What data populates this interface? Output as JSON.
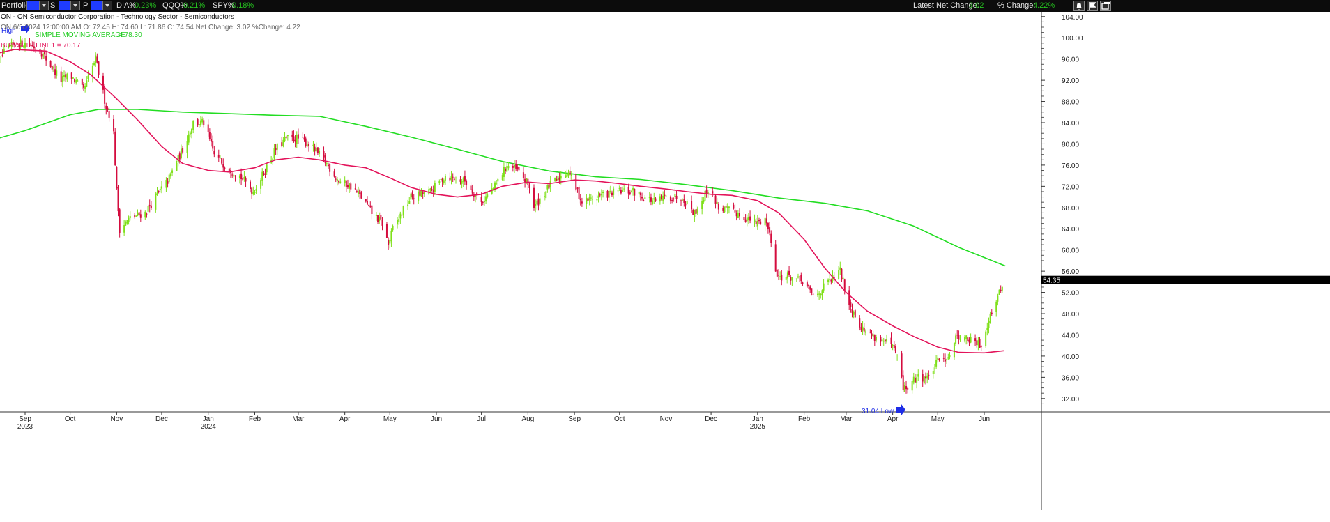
{
  "toolbar": {
    "portfolio_label": "Portfolio",
    "s_label": "S",
    "p_label": "P",
    "tickers": [
      {
        "name": "DIA%",
        "value": "0.23%"
      },
      {
        "name": "QQQ%",
        "value": "0.21%"
      },
      {
        "name": "SPY%",
        "value": "0.18%"
      }
    ],
    "latest_net_change_label": "Latest Net Change:",
    "latest_net_change_value": "3.02",
    "pct_change_label": "% Change:",
    "pct_change_value": "4.22%",
    "icons": [
      "bell-icon",
      "flag-icon",
      "window-icon"
    ]
  },
  "header": {
    "title": "ON - ON Semiconductor Corporation - Technology Sector - Semiconductors",
    "ohlc": "ON 6/5/2024 12:00:00 AM O: 72.45 H: 74.60 L: 71.86 C: 74.54 Net Change: 3.02  %Change: 4.22",
    "sma_label": "SIMPLE MOVING AVERAGE",
    "sma_value": "= 78.30",
    "bsl_label": "BUY/SELL LINE1 = 70.17",
    "high_marker": "High"
  },
  "colors": {
    "up": "#7fe01a",
    "down": "#d40c3e",
    "sma": "#22dd22",
    "bsl": "#e3135a",
    "marker": "#1e2de6"
  },
  "chart_data": {
    "type": "candlestick",
    "ylim": [
      31,
      105
    ],
    "yticks": [
      104,
      100,
      96,
      92,
      88,
      84,
      80,
      76,
      72,
      68,
      64,
      60,
      56,
      52,
      48,
      44,
      40,
      36,
      32
    ],
    "last_price": "54.35",
    "low_annotation": "31.04 Low",
    "months": [
      {
        "label": "Sep",
        "year": "2023",
        "date": "2023-09-01"
      },
      {
        "label": "Oct",
        "date": "2023-10-01"
      },
      {
        "label": "Nov",
        "date": "2023-11-01"
      },
      {
        "label": "Dec",
        "date": "2023-12-01"
      },
      {
        "label": "Jan",
        "year": "2024",
        "date": "2024-01-01"
      },
      {
        "label": "Feb",
        "date": "2024-02-01"
      },
      {
        "label": "Mar",
        "date": "2024-03-01"
      },
      {
        "label": "Apr",
        "date": "2024-04-01"
      },
      {
        "label": "May",
        "date": "2024-05-01"
      },
      {
        "label": "Jun",
        "date": "2024-06-01"
      },
      {
        "label": "Jul",
        "date": "2024-07-01"
      },
      {
        "label": "Aug",
        "date": "2024-08-01"
      },
      {
        "label": "Sep",
        "date": "2024-09-01"
      },
      {
        "label": "Oct",
        "date": "2024-10-01"
      },
      {
        "label": "Nov",
        "date": "2024-11-01"
      },
      {
        "label": "Dec",
        "date": "2024-12-01"
      },
      {
        "label": "Jan",
        "year": "2025",
        "date": "2025-01-01"
      },
      {
        "label": "Feb",
        "date": "2025-02-01"
      },
      {
        "label": "Mar",
        "date": "2025-03-01"
      },
      {
        "label": "Apr",
        "date": "2025-04-01"
      },
      {
        "label": "May",
        "date": "2025-05-01"
      },
      {
        "label": "Jun",
        "date": "2025-06-01"
      }
    ],
    "price_path": [
      [
        "2023-08-08",
        91
      ],
      [
        "2023-08-12",
        95
      ],
      [
        "2023-08-18",
        97
      ],
      [
        "2023-08-25",
        99
      ],
      [
        "2023-09-01",
        99
      ],
      [
        "2023-09-10",
        98
      ],
      [
        "2023-09-15",
        96
      ],
      [
        "2023-09-25",
        92
      ],
      [
        "2023-10-01",
        93
      ],
      [
        "2023-10-10",
        90
      ],
      [
        "2023-10-18",
        96
      ],
      [
        "2023-10-25",
        87
      ],
      [
        "2023-10-28",
        85
      ],
      [
        "2023-10-30",
        82
      ],
      [
        "2023-11-01",
        71
      ],
      [
        "2023-11-03",
        64
      ],
      [
        "2023-11-10",
        66
      ],
      [
        "2023-11-20",
        67
      ],
      [
        "2023-11-27",
        70
      ],
      [
        "2023-12-05",
        73
      ],
      [
        "2023-12-15",
        79
      ],
      [
        "2023-12-22",
        84
      ],
      [
        "2023-12-29",
        84
      ],
      [
        "2024-01-05",
        78
      ],
      [
        "2024-01-12",
        76
      ],
      [
        "2024-01-22",
        74
      ],
      [
        "2024-01-31",
        71
      ],
      [
        "2024-02-06",
        74
      ],
      [
        "2024-02-15",
        79
      ],
      [
        "2024-02-22",
        81
      ],
      [
        "2024-03-01",
        81
      ],
      [
        "2024-03-08",
        80
      ],
      [
        "2024-03-18",
        77
      ],
      [
        "2024-03-28",
        73
      ],
      [
        "2024-04-05",
        72
      ],
      [
        "2024-04-12",
        70
      ],
      [
        "2024-04-19",
        67
      ],
      [
        "2024-04-26",
        65
      ],
      [
        "2024-04-30",
        61
      ],
      [
        "2024-05-03",
        64
      ],
      [
        "2024-05-15",
        70
      ],
      [
        "2024-05-28",
        71
      ],
      [
        "2024-06-07",
        74
      ],
      [
        "2024-06-20",
        73
      ],
      [
        "2024-07-01",
        69
      ],
      [
        "2024-07-10",
        72
      ],
      [
        "2024-07-18",
        76
      ],
      [
        "2024-07-25",
        75
      ],
      [
        "2024-08-02",
        72
      ],
      [
        "2024-08-05",
        68
      ],
      [
        "2024-08-15",
        72
      ],
      [
        "2024-08-28",
        75
      ],
      [
        "2024-09-06",
        69
      ],
      [
        "2024-09-15",
        70
      ],
      [
        "2024-09-30",
        71
      ],
      [
        "2024-10-10",
        71
      ],
      [
        "2024-10-25",
        69
      ],
      [
        "2024-11-01",
        70
      ],
      [
        "2024-11-12",
        70
      ],
      [
        "2024-11-20",
        67
      ],
      [
        "2024-11-30",
        72
      ],
      [
        "2024-12-06",
        68
      ],
      [
        "2024-12-18",
        67
      ],
      [
        "2024-12-31",
        65
      ],
      [
        "2025-01-06",
        66
      ],
      [
        "2025-01-10",
        62
      ],
      [
        "2025-01-14",
        55
      ],
      [
        "2025-01-22",
        55
      ],
      [
        "2025-01-31",
        54
      ],
      [
        "2025-02-08",
        51
      ],
      [
        "2025-02-14",
        53
      ],
      [
        "2025-02-25",
        56
      ],
      [
        "2025-03-03",
        50
      ],
      [
        "2025-03-12",
        45
      ],
      [
        "2025-03-24",
        43
      ],
      [
        "2025-03-31",
        42
      ],
      [
        "2025-04-04",
        40
      ],
      [
        "2025-04-08",
        34
      ],
      [
        "2025-04-11",
        34
      ],
      [
        "2025-04-17",
        36
      ],
      [
        "2025-04-25",
        36
      ],
      [
        "2025-05-01",
        39
      ],
      [
        "2025-05-08",
        40
      ],
      [
        "2025-05-14",
        44
      ],
      [
        "2025-05-22",
        43
      ],
      [
        "2025-05-30",
        42
      ],
      [
        "2025-06-05",
        48
      ],
      [
        "2025-06-10",
        51
      ],
      [
        "2025-06-14",
        54.35
      ]
    ],
    "series": [
      {
        "name": "SIMPLE MOVING AVERAGE",
        "points": [
          [
            "2023-08-01",
            80
          ],
          [
            "2023-09-01",
            82.5
          ],
          [
            "2023-10-01",
            85.5
          ],
          [
            "2023-10-20",
            86.5
          ],
          [
            "2023-11-15",
            86.5
          ],
          [
            "2023-12-15",
            86
          ],
          [
            "2024-01-15",
            85.7
          ],
          [
            "2024-02-15",
            85.4
          ],
          [
            "2024-03-15",
            85.2
          ],
          [
            "2024-04-15",
            83.3
          ],
          [
            "2024-05-15",
            81.3
          ],
          [
            "2024-06-15",
            79
          ],
          [
            "2024-07-15",
            76.7
          ],
          [
            "2024-08-15",
            74.9
          ],
          [
            "2024-09-15",
            73.8
          ],
          [
            "2024-10-15",
            73.3
          ],
          [
            "2024-11-15",
            72.3
          ],
          [
            "2024-12-15",
            71.2
          ],
          [
            "2025-01-15",
            69.8
          ],
          [
            "2025-02-15",
            68.8
          ],
          [
            "2025-03-15",
            67.4
          ],
          [
            "2025-04-15",
            64.5
          ],
          [
            "2025-05-15",
            60.5
          ],
          [
            "2025-06-15",
            57
          ]
        ]
      },
      {
        "name": "BUY/SELL LINE1",
        "points": [
          [
            "2023-08-01",
            96.3
          ],
          [
            "2023-08-25",
            97.8
          ],
          [
            "2023-09-15",
            97.5
          ],
          [
            "2023-10-01",
            95.5
          ],
          [
            "2023-10-15",
            93
          ],
          [
            "2023-11-01",
            88.5
          ],
          [
            "2023-11-15",
            84.5
          ],
          [
            "2023-12-01",
            79.5
          ],
          [
            "2023-12-15",
            76.3
          ],
          [
            "2024-01-01",
            75
          ],
          [
            "2024-01-15",
            74.7
          ],
          [
            "2024-02-01",
            75.5
          ],
          [
            "2024-02-15",
            77
          ],
          [
            "2024-03-01",
            77.5
          ],
          [
            "2024-03-15",
            77
          ],
          [
            "2024-04-01",
            76
          ],
          [
            "2024-04-15",
            75.5
          ],
          [
            "2024-05-01",
            73.6
          ],
          [
            "2024-05-15",
            71.8
          ],
          [
            "2024-06-01",
            70.5
          ],
          [
            "2024-06-15",
            70
          ],
          [
            "2024-07-01",
            70.5
          ],
          [
            "2024-07-15",
            72
          ],
          [
            "2024-08-01",
            72.8
          ],
          [
            "2024-08-15",
            72.5
          ],
          [
            "2024-09-01",
            73.2
          ],
          [
            "2024-09-15",
            73
          ],
          [
            "2024-10-01",
            72.5
          ],
          [
            "2024-10-15",
            72
          ],
          [
            "2024-11-01",
            71.5
          ],
          [
            "2024-11-15",
            71
          ],
          [
            "2024-12-01",
            70.5
          ],
          [
            "2024-12-15",
            70.3
          ],
          [
            "2025-01-01",
            69.3
          ],
          [
            "2025-01-15",
            67
          ],
          [
            "2025-02-01",
            62
          ],
          [
            "2025-02-15",
            56.5
          ],
          [
            "2025-03-01",
            52
          ],
          [
            "2025-03-15",
            48.5
          ],
          [
            "2025-04-01",
            45.7
          ],
          [
            "2025-04-15",
            43.7
          ],
          [
            "2025-05-01",
            41.7
          ],
          [
            "2025-05-15",
            40.7
          ],
          [
            "2025-06-01",
            40.6
          ],
          [
            "2025-06-14",
            41
          ]
        ]
      }
    ]
  }
}
